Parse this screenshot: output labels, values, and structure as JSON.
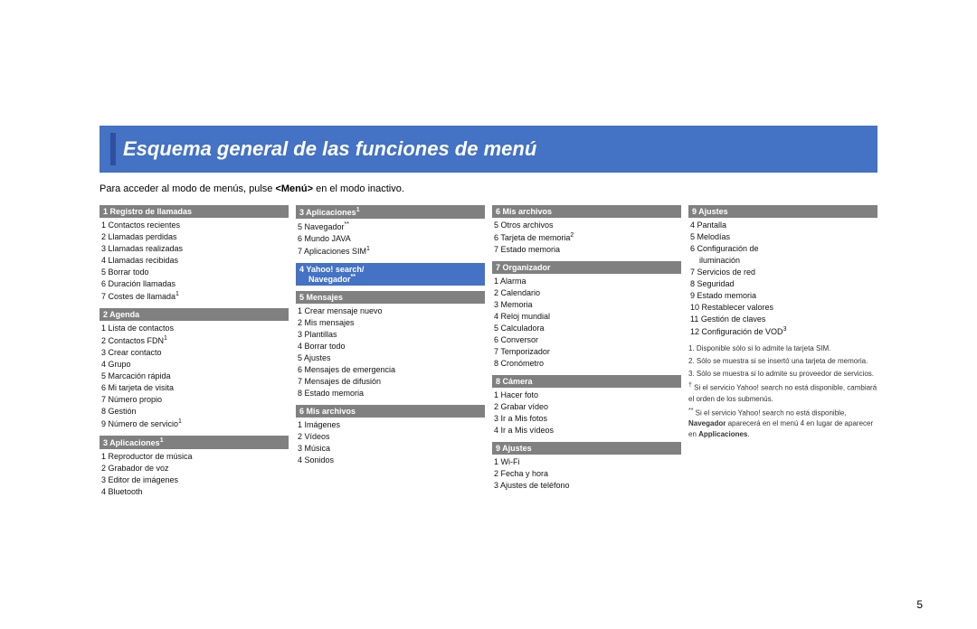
{
  "title": "Esquema general de las funciones de menú",
  "subtitle": "Para acceder al modo de menús, pulse <Menú> en el modo inactivo.",
  "page_number": "5",
  "col1": {
    "sections": [
      {
        "id": "reg-llamadas",
        "header": "1  Registro de llamadas",
        "items": [
          "1  Contactos recientes",
          "2  Llamadas perdidas",
          "3  Llamadas realizadas",
          "4  Llamadas recibidas",
          "5  Borrar todo",
          "6  Duración llamadas",
          "7  Costes de llamada¹"
        ]
      },
      {
        "id": "agenda",
        "header": "2  Agenda",
        "items": [
          "1  Lista de contactos",
          "2  Contactos FDN¹",
          "3  Crear contacto",
          "4  Grupo",
          "5  Marcación rápida",
          "6  Mi tarjeta de visita",
          "7  Número propio",
          "8  Gestión",
          "9  Número de servicio¹"
        ]
      },
      {
        "id": "aplicaciones1",
        "header": "3  Aplicaciones¹",
        "items": [
          "1  Reproductor de música",
          "2  Grabador de voz",
          "3  Editor de imágenes",
          "4  Bluetooth"
        ]
      }
    ]
  },
  "col2": {
    "sections": [
      {
        "id": "aplicaciones3",
        "header": "3  Aplicaciones¹",
        "items": [
          "5  Navegador**",
          "6  Mundo JAVA",
          "7  Aplicaciones SIM¹"
        ]
      },
      {
        "id": "yahoo",
        "header": "4  Yahoo! search/ Navegador**",
        "header_line2": "Navegador**",
        "items": []
      },
      {
        "id": "mensajes",
        "header": "5  Mensajes",
        "items": [
          "1  Crear mensaje nuevo",
          "2  Mis mensajes",
          "3  Plantillas",
          "4  Borrar todo",
          "5  Ajustes",
          "6  Mensajes de emergencia",
          "7  Mensajes de difusión",
          "8  Estado memoria"
        ]
      },
      {
        "id": "mis-archivos2",
        "header": "6  Mis archivos",
        "items": [
          "1  Imágenes",
          "2  Vídeos",
          "3  Música",
          "4  Sonidos"
        ]
      }
    ]
  },
  "col3": {
    "sections": [
      {
        "id": "mis-archivos3",
        "header": "6  Mis archivos",
        "items": [
          "5  Otros archivos",
          "6  Tarjeta de memoria²",
          "7  Estado memoria"
        ]
      },
      {
        "id": "organizador",
        "header": "7  Organizador",
        "items": [
          "1  Alarma",
          "2  Calendario",
          "3  Memoria",
          "4  Reloj mundial",
          "5  Calculadora",
          "6  Conversor",
          "7  Temporizador",
          "8  Cronómetro"
        ]
      },
      {
        "id": "camara",
        "header": "8  Cámera",
        "items": [
          "1  Hacer foto",
          "2  Grabar vídeo",
          "3  Ir a Mis fotos",
          "4  Ir a Mis vídeos"
        ]
      },
      {
        "id": "ajustes2",
        "header": "9  Ajustes",
        "items": [
          "1  Wi-Fi",
          "2  Fecha y hora",
          "3  Ajustes de teléfono"
        ]
      }
    ]
  },
  "col4": {
    "sections": [
      {
        "id": "ajustes4",
        "header": "9  Ajustes",
        "items": [
          "4  Pantalla",
          "5  Melodías",
          "6  Configuración de iluminación",
          "7  Servicios de red",
          "8  Seguridad",
          "9  Estado memoria",
          "10  Restablecer valores",
          "11  Gestión de claves",
          "12  Configuración de VOD³"
        ]
      }
    ],
    "footnotes": [
      "1.  Disponible sólo si lo admite la tarjeta SIM.",
      "2.  Sólo se muestra si se insertó una tarjeta de memoria.",
      "3.  Sólo se muestra si lo admite su proveedor de servicios.",
      "†  Si el servicio Yahoo! search no está disponible, cambiará el orden de los submenús.",
      "**  Si el servicio Yahoo! search no está disponible, Navegador aparecerá en el menú 4 en lugar de aparecer en Applicaciones."
    ]
  }
}
